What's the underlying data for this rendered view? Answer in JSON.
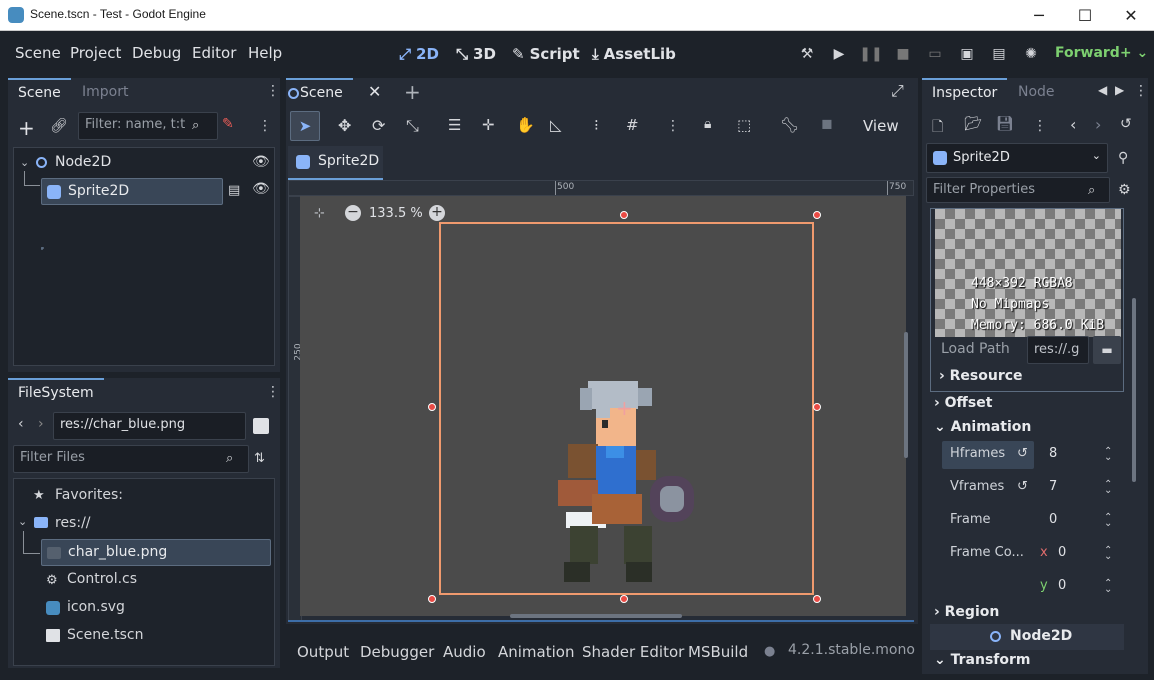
{
  "window": {
    "title": "Scene.tscn - Test - Godot Engine"
  },
  "menu": [
    "Scene",
    "Project",
    "Debug",
    "Editor",
    "Help"
  ],
  "workspaces": [
    {
      "label": "2D",
      "icon": "2d-icon"
    },
    {
      "label": "3D",
      "icon": "3d-icon"
    },
    {
      "label": "Script",
      "icon": "script-icon"
    },
    {
      "label": "AssetLib",
      "icon": "assetlib-icon"
    }
  ],
  "renderer": "Forward+",
  "scene_dock": {
    "tabs": [
      "Scene",
      "Import"
    ],
    "filter_placeholder": "Filter: name, t:t",
    "nodes": [
      {
        "name": "Node2D",
        "type": "node2d"
      },
      {
        "name": "Sprite2D",
        "type": "sprite2d"
      }
    ]
  },
  "filesystem": {
    "tab": "FileSystem",
    "path": "res://char_blue.png",
    "filter_placeholder": "Filter Files",
    "items": [
      {
        "label": "Favorites:",
        "icon": "star-icon"
      },
      {
        "label": "res://",
        "icon": "folder-icon"
      },
      {
        "label": "char_blue.png",
        "icon": "image-icon"
      },
      {
        "label": "Control.cs",
        "icon": "gear-icon"
      },
      {
        "label": "icon.svg",
        "icon": "godot-icon"
      },
      {
        "label": "Scene.tscn",
        "icon": "scene-icon"
      }
    ]
  },
  "editor": {
    "scene_tab": "Scene",
    "breadcrumb": "Sprite2D",
    "view_label": "View",
    "zoom": "133.5 %",
    "ruler_top": [
      "500",
      "750"
    ],
    "ruler_left": [
      "250"
    ]
  },
  "bottom_panel": {
    "tabs": [
      "Output",
      "Debugger",
      "Audio",
      "Animation",
      "Shader Editor",
      "MSBuild"
    ],
    "version": "4.2.1.stable.mono"
  },
  "inspector": {
    "tabs": [
      "Inspector",
      "Node"
    ],
    "node_selector": "Sprite2D",
    "filter_placeholder": "Filter Properties",
    "texture_info": [
      "448×392 RGBA8",
      "No Mipmaps",
      "Memory: 686.0 KiB"
    ],
    "load_path_label": "Load Path",
    "load_path_value": "res://.g",
    "sections": {
      "resource": "Resource",
      "offset": "Offset",
      "animation": "Animation",
      "region": "Region",
      "transform": "Transform"
    },
    "props": {
      "hframes": {
        "label": "Hframes",
        "value": "8"
      },
      "vframes": {
        "label": "Vframes",
        "value": "7"
      },
      "frame": {
        "label": "Frame",
        "value": "0"
      },
      "frame_coords": {
        "label": "Frame Co...",
        "x_label": "x",
        "x": "0",
        "y_label": "y",
        "y": "0"
      }
    },
    "parent_node": "Node2D"
  }
}
